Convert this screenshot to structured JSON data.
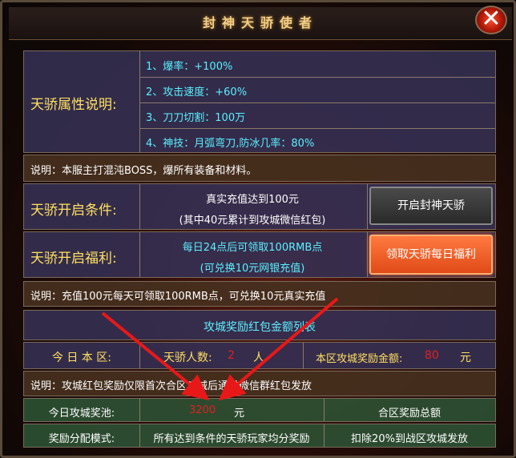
{
  "window": {
    "title": "封神天骄使者"
  },
  "attributes": {
    "label": "天骄属性说明:",
    "items": [
      "1、爆率：+100%",
      "2、攻击速度：+60%",
      "3、刀刀切割：100万",
      "4、神技：月弧弯刀,防冰几率：80%"
    ]
  },
  "note1": "说明：本服主打混沌BOSS，爆所有装备和材料。",
  "open_condition": {
    "label": "天骄开启条件:",
    "line1": "真实充值达到100元",
    "line2": "(其中40元累计到攻城微信红包)",
    "button": "开启封神天骄"
  },
  "open_welfare": {
    "label": "天骄开启福利:",
    "line1": "每日24点后可领取100RMB点",
    "line2": "(可兑换10元网银充值)",
    "button": "领取天骄每日福利"
  },
  "note2": "说明：充值100元每天可领取100RMB点，可兑换10元真实充值",
  "red_packet": {
    "heading": "攻城奖励红包金额列表",
    "today_label": "今 日 本 区:",
    "count_label": "天骄人数:",
    "count_value": "2",
    "count_unit": "人",
    "amount_label": "本区攻城奖励金额:",
    "amount_value": "80",
    "amount_unit": "元"
  },
  "note3": "说明：攻城红包奖励仅限首次合区攻城后通过微信群红包发放",
  "pool": {
    "label": "今日攻城奖池:",
    "value": "3200",
    "unit": "元",
    "merge_label": "合区奖励总额"
  },
  "distribution": {
    "label": "奖励分配模式:",
    "mode": "所有达到条件的天骄玩家均分奖励",
    "deduct": "扣除20%到战区攻城发放"
  },
  "colors": {
    "accent_red": "#e02020",
    "cyan": "#5af0ff",
    "gold": "#f0d08a"
  }
}
